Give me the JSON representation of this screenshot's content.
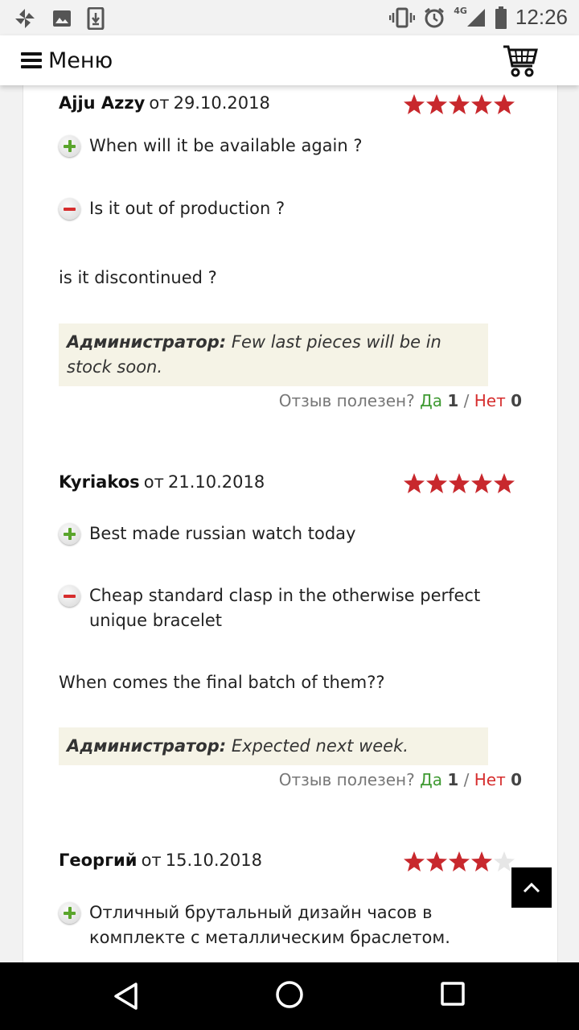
{
  "status_bar": {
    "time": "12:26",
    "network": "4G",
    "icons": [
      "pinwheel-icon",
      "image-icon",
      "download-icon",
      "vibrate-icon",
      "alarm-icon",
      "signal-icon",
      "battery-icon"
    ]
  },
  "header": {
    "menu_label": "Меню",
    "cart_icon": "shopping-cart-icon"
  },
  "reviews": [
    {
      "author": "Ajju Azzy",
      "date_prefix": "от",
      "date": "29.10.2018",
      "rating": 5,
      "pros": "When will it be available again ?",
      "cons": "Is it out of production ?",
      "comment": "is it discontinued ?",
      "admin_label": "Администратор:",
      "admin_reply": "Few last pieces will be in stock soon.",
      "useful_q": "Отзыв полезен?",
      "yes_label": "Да",
      "yes_count": "1",
      "no_label": "Нет",
      "no_count": "0"
    },
    {
      "author": "Kyriakos",
      "date_prefix": "от",
      "date": "21.10.2018",
      "rating": 5,
      "pros": "Best made russian watch today",
      "cons": "Cheap standard clasp in the otherwise perfect unique bracelet",
      "comment": "When comes the final batch of them??",
      "admin_label": "Администратор:",
      "admin_reply": "Expected next week.",
      "useful_q": "Отзыв полезен?",
      "yes_label": "Да",
      "yes_count": "1",
      "no_label": "Нет",
      "no_count": "0"
    },
    {
      "author": "Георгий",
      "date_prefix": "от",
      "date": "15.10.2018",
      "rating": 4,
      "pros": "Отличный брутальный дизайн часов в комплекте с металлическим браслетом."
    }
  ],
  "colors": {
    "star_filled": "#c8282d",
    "star_empty": "#e6e6e6",
    "yes": "#3f9a32",
    "no": "#d62d2d",
    "admin_bg": "#f5f3e6"
  }
}
